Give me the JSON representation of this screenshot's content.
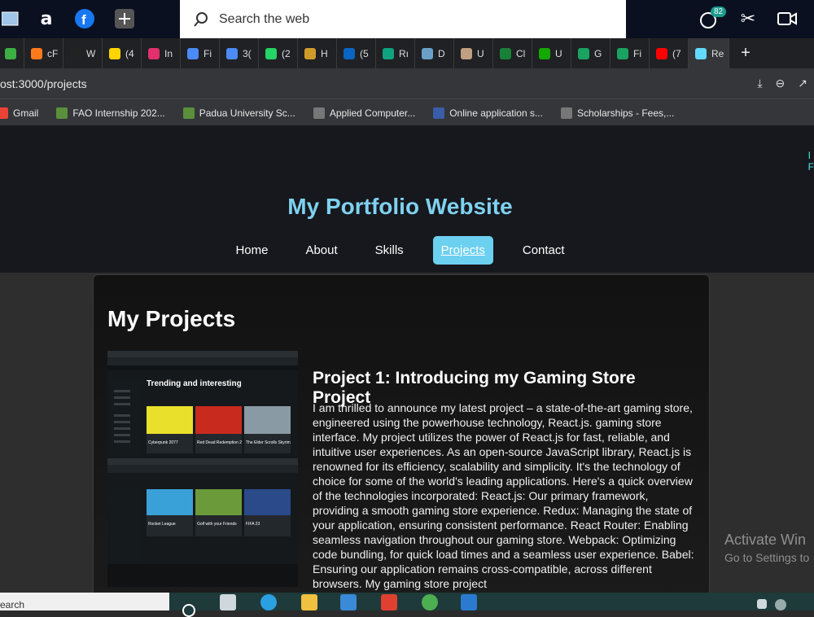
{
  "os": {
    "search_placeholder": "Search the web",
    "notification_count": "82"
  },
  "browser": {
    "tabs": [
      {
        "label": "cF",
        "color": "#ff7a1a"
      },
      {
        "label": "W",
        "color": "#222"
      },
      {
        "label": "(4",
        "color": "#ffd400"
      },
      {
        "label": "In",
        "color": "#e1306c"
      },
      {
        "label": "Fi",
        "color": "#4c8bf5"
      },
      {
        "label": "3(",
        "color": "#4c8bf5"
      },
      {
        "label": "(2",
        "color": "#25d366"
      },
      {
        "label": "H",
        "color": "#d19b2a"
      },
      {
        "label": "(5",
        "color": "#0a66c2"
      },
      {
        "label": "Rı",
        "color": "#10a37f"
      },
      {
        "label": "D",
        "color": "#6aa0c8"
      },
      {
        "label": "U",
        "color": "#c0a080"
      },
      {
        "label": "Cl",
        "color": "#188038"
      },
      {
        "label": "U",
        "color": "#14a800"
      },
      {
        "label": "G",
        "color": "#1aa260"
      },
      {
        "label": "Fi",
        "color": "#1aa260"
      },
      {
        "label": "(7",
        "color": "#ff0000"
      },
      {
        "label": "Re",
        "color": "#61dafb"
      }
    ],
    "address": "ost:3000/projects",
    "bookmarks": [
      {
        "label": "Gmail",
        "color": "#ea4335"
      },
      {
        "label": "FAO Internship 202...",
        "color": "#5a8f3c"
      },
      {
        "label": "Padua University Sc...",
        "color": "#5a8f3c"
      },
      {
        "label": "Applied Computer...",
        "color": "#777"
      },
      {
        "label": "Online application s...",
        "color": "#3a5da8"
      },
      {
        "label": "Scholarships - Fees,...",
        "color": "#777"
      }
    ]
  },
  "site": {
    "title": "My Portfolio Website",
    "nav": [
      "Home",
      "About",
      "Skills",
      "Projects",
      "Contact"
    ],
    "active_nav": "Projects",
    "side_text": [
      "I",
      "F"
    ]
  },
  "projects": {
    "heading": "My Projects",
    "items": [
      {
        "title": "Project 1: Introducing my Gaming Store Project",
        "description": "I am thrilled to announce my latest project – a state-of-the-art gaming store, engineered using the powerhouse technology, React.js. gaming store interface. My project utilizes the power of React.js for fast, reliable, and intuitive user experiences. As an open-source JavaScript library, React.js is renowned for its efficiency, scalability and simplicity. It's the technology of choice for some of the world's leading applications. Here's a quick overview of the technologies incorporated: React.js: Our primary framework, providing a smooth gaming store experience. Redux: Managing the state of your application, ensuring consistent performance. React Router: Enabling seamless navigation throughout our gaming store. Webpack: Optimizing code bundling, for quick load times and a seamless user experience. Babel: Ensuring our application remains cross-compatible, across different browsers. My gaming store project"
      }
    ],
    "screenshot": {
      "heading": "Trending and interesting",
      "games": [
        "Cyberpunk 2077",
        "Red Dead Redemption 2",
        "The Elder Scrolls Skyrim",
        "Rocket League",
        "Golf with your Friends",
        "FIFA 23"
      ]
    }
  },
  "watermark": {
    "title": "Activate Win",
    "subtitle": "Go to Settings to"
  },
  "taskbar": {
    "search_label": "earch"
  }
}
